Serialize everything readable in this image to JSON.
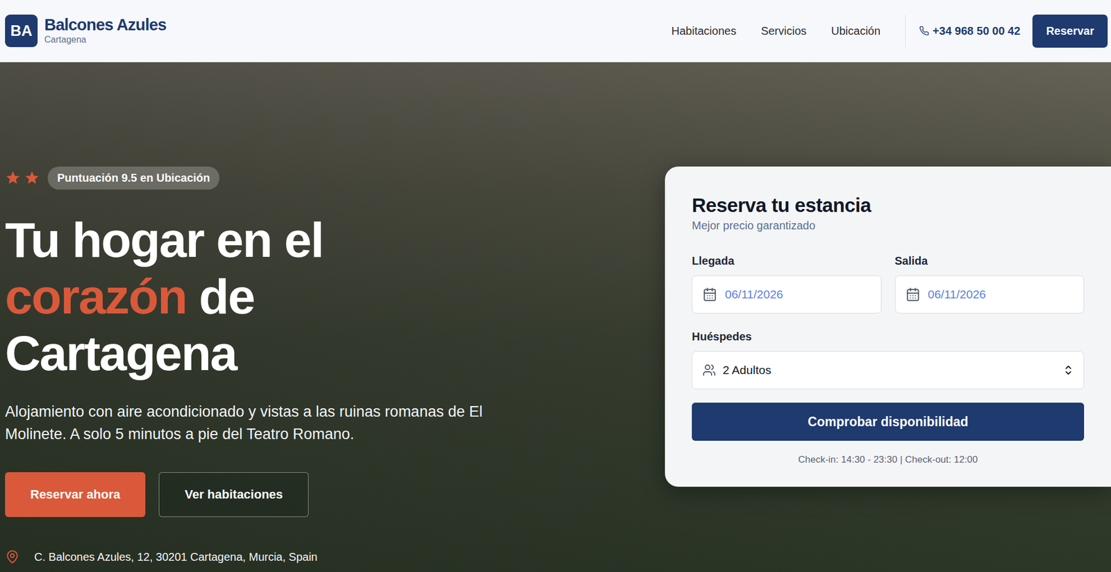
{
  "header": {
    "logo": "BA",
    "brand": "Balcones Azules",
    "city": "Cartagena",
    "nav": [
      "Habitaciones",
      "Servicios",
      "Ubicación"
    ],
    "phone": "+34 968 50 00 42",
    "cta": "Reservar"
  },
  "hero": {
    "stars": 2,
    "badge": "Puntuación 9.5 en Ubicación",
    "headline": [
      [
        {
          "text": "Tu hogar en el",
          "accent": false
        }
      ],
      [
        {
          "text": "corazón",
          "accent": true
        },
        {
          "text": "de",
          "accent": false
        }
      ],
      [
        {
          "text": "Cartagena",
          "accent": false
        }
      ]
    ],
    "subtitle": "Alojamiento con aire acondicionado y vistas a las ruinas romanas de El Molinete. A solo 5 minutos a pie del Teatro Romano.",
    "buttons": [
      {
        "label": "Reservar ahora",
        "kind": "primary"
      },
      {
        "label": "Ver habitaciones",
        "kind": "secondary"
      }
    ],
    "address": "C. Balcones Azules, 12, 30201 Cartagena, Murcia, Spain"
  },
  "booking": {
    "title": "Reserva tu estancia",
    "subtitle": "Mejor precio garantizado",
    "dates": [
      {
        "label": "Llegada",
        "value": "06/11/2026"
      },
      {
        "label": "Salida",
        "value": "06/11/2026"
      }
    ],
    "guests": {
      "label": "Huéspedes",
      "value": "2 Adultos"
    },
    "submit": "Comprobar disponibilidad",
    "note": "Check-in: 14:30 - 23:30 | Check-out: 12:00"
  }
}
